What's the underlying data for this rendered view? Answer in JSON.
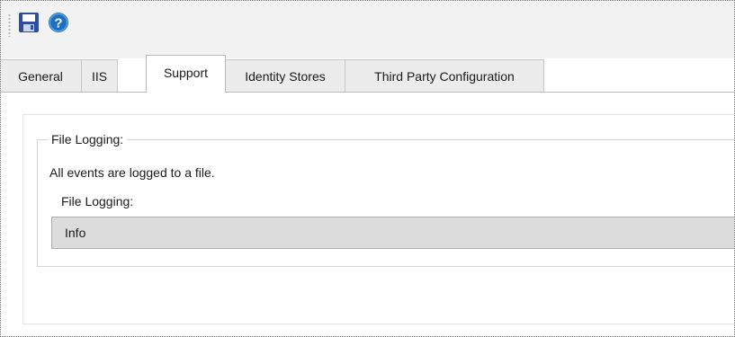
{
  "toolbar": {
    "icons": [
      "save-icon",
      "help-icon"
    ]
  },
  "tabs": [
    {
      "label": "General",
      "active": false
    },
    {
      "label": "IIS",
      "active": false
    },
    {
      "label": "Support",
      "active": true
    },
    {
      "label": "Identity Stores",
      "active": false
    },
    {
      "label": "Third Party Configuration",
      "active": false
    }
  ],
  "file_logging": {
    "group_title": "File Logging:",
    "description": "All events are logged to a file.",
    "field_label": "File Logging:",
    "value": "Info"
  },
  "colors": {
    "toolbar_bg": "#f2f2f2",
    "save_icon": "#2f4d9c",
    "help_icon": "#1f6fbf",
    "select_bg": "#dcdcdc"
  }
}
